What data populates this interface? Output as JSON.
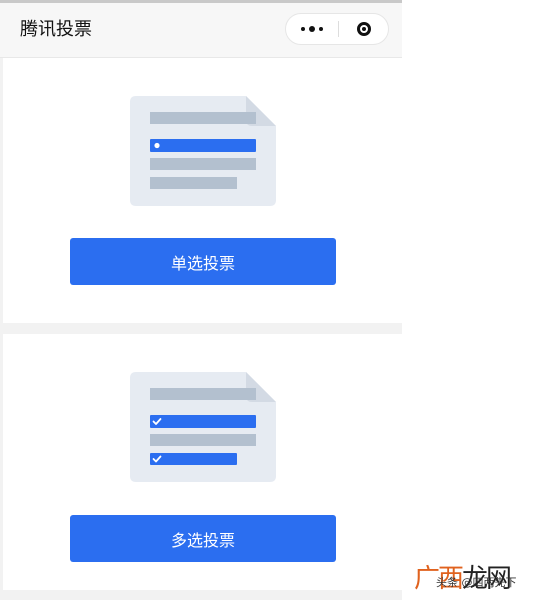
{
  "navbar": {
    "title": "腾讯投票"
  },
  "cards": [
    {
      "button_label": "单选投票",
      "icon": "single-choice-form-icon"
    },
    {
      "button_label": "多选投票",
      "icon": "multi-choice-form-icon"
    }
  ],
  "watermark": {
    "brand_part1": "广西",
    "brand_part2": "龙网",
    "sub": "头条 @四两先下"
  },
  "colors": {
    "accent": "#2b6ef0",
    "doc_bg": "#e6ebf2",
    "doc_bar": "#b3c0cf",
    "watermark": "#e0621e"
  }
}
